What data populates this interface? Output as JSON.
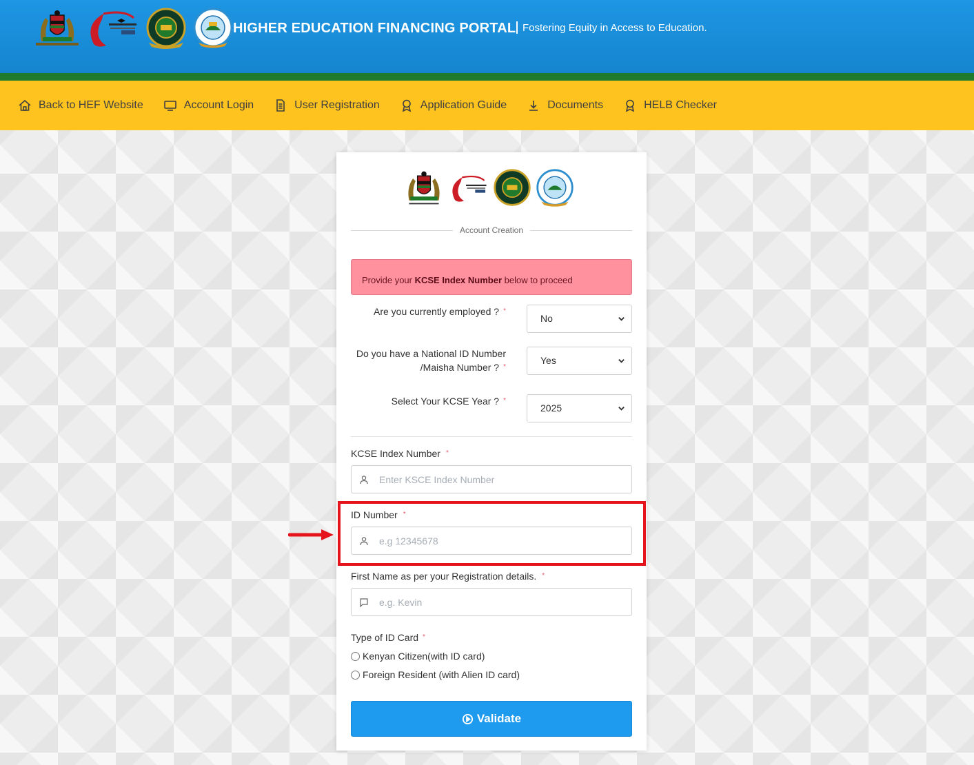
{
  "header": {
    "title": "HIGHER EDUCATION FINANCING PORTAL",
    "tagline": "Fostering Equity in Access to Education.",
    "logos": [
      "kenya-coat-of-arms",
      "ministry-of-education",
      "helb-seal",
      "universities-fund-seal"
    ],
    "colors": {
      "header_blue": "#1a8ddb",
      "strip_green": "#1f7a2c",
      "nav_yellow": "#ffc31f"
    }
  },
  "nav": {
    "items": [
      {
        "label": "Back to HEF Website",
        "icon": "home-icon"
      },
      {
        "label": "Account Login",
        "icon": "monitor-icon"
      },
      {
        "label": "User Registration",
        "icon": "document-icon"
      },
      {
        "label": "Application Guide",
        "icon": "award-icon"
      },
      {
        "label": "Documents",
        "icon": "download-icon"
      },
      {
        "label": "HELB Checker",
        "icon": "award-icon"
      }
    ]
  },
  "card": {
    "section_title": "Account Creation",
    "alert": {
      "prefix": "Provide your ",
      "bold": "KCSE Index Number",
      "suffix": " below to proceed"
    },
    "questions": [
      {
        "label": "Are you currently employed ?",
        "value": "No"
      },
      {
        "label": "Do you have a National ID Number /Maisha Number ?",
        "value": "Yes"
      },
      {
        "label": "Select Your KCSE Year ?",
        "value": "2025"
      }
    ],
    "fields": {
      "kcse": {
        "label": "KCSE Index Number",
        "placeholder": "Enter KSCE Index Number",
        "value": ""
      },
      "id_number": {
        "label": "ID Number",
        "placeholder": "e.g 12345678",
        "value": ""
      },
      "first_name": {
        "label": "First Name as per your Registration details.",
        "placeholder": "e.g. Kevin",
        "value": ""
      }
    },
    "id_card": {
      "label": "Type of ID Card",
      "options": [
        "Kenyan Citizen(with ID card)",
        "Foreign Resident (with Alien ID card)"
      ]
    },
    "required_mark": "*",
    "validate_label": "Validate",
    "colors": {
      "alert_bg": "#ff909e",
      "button_blue": "#1e9bee",
      "highlight_red": "#e5131c"
    }
  }
}
